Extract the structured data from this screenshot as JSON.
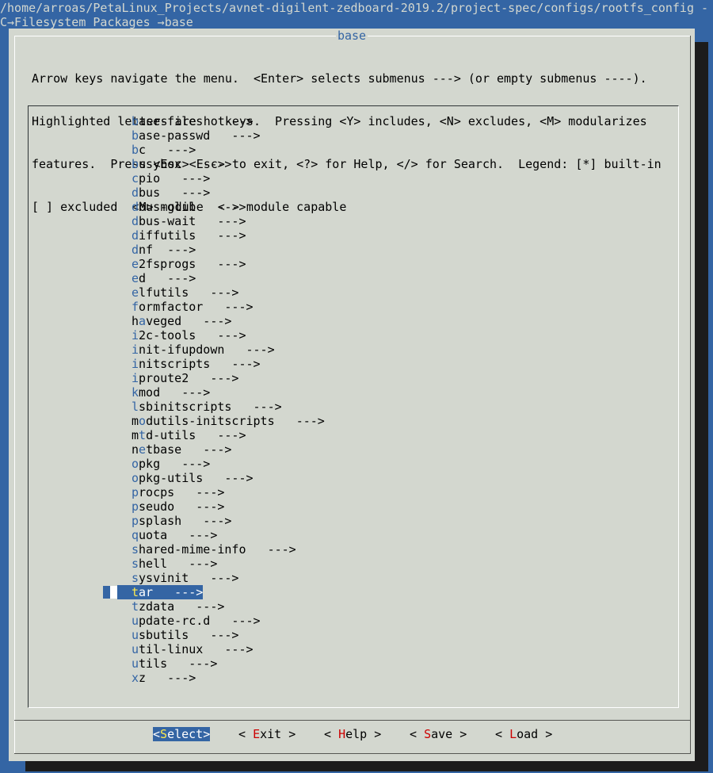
{
  "terminal": {
    "path_line": "/home/arroas/PetaLinux_Projects/avnet-digilent-zedboard-2019.2/project-spec/configs/rootfs_config - ",
    "breadcrumb": "C→Filesystem Packages →base"
  },
  "dialog": {
    "title": "base",
    "help_lines": [
      "Arrow keys navigate the menu.  <Enter> selects submenus ---> (or empty submenus ----).",
      "Highlighted letters are hotkeys.  Pressing <Y> includes, <N> excludes, <M> modularizes",
      "features.  Press <Esc><Esc> to exit, <?> for Help, </> for Search.  Legend: [*] built-in",
      "[ ] excluded  <M> module  < > module capable"
    ]
  },
  "menu": {
    "items": [
      {
        "hot": "b",
        "rest": "ase-files   --->"
      },
      {
        "hot": "b",
        "rest": "ase-passwd   --->"
      },
      {
        "hot": "b",
        "rest": "c   --->"
      },
      {
        "hot": "b",
        "rest": "usybox   --->"
      },
      {
        "hot": "c",
        "rest": "pio   --->"
      },
      {
        "hot": "d",
        "rest": "bus   --->"
      },
      {
        "hot": "d",
        "rest": "bus-glib   --->"
      },
      {
        "hot": "d",
        "rest": "bus-wait   --->"
      },
      {
        "hot": "d",
        "rest": "iffutils   --->"
      },
      {
        "hot": "d",
        "rest": "nf  --->"
      },
      {
        "hot": "e",
        "rest": "2fsprogs   --->"
      },
      {
        "hot": "e",
        "rest": "d   --->"
      },
      {
        "hot": "e",
        "rest": "lfutils   --->"
      },
      {
        "hot": "f",
        "rest": "ormfactor   --->"
      },
      {
        "pre": "h",
        "hot": "a",
        "rest": "veged   --->"
      },
      {
        "hot": "i",
        "rest": "2c-tools   --->"
      },
      {
        "hot": "i",
        "rest": "nit-ifupdown   --->"
      },
      {
        "hot": "i",
        "rest": "nitscripts   --->"
      },
      {
        "hot": "i",
        "rest": "proute2   --->"
      },
      {
        "hot": "k",
        "rest": "mod   --->"
      },
      {
        "hot": "l",
        "rest": "sbinitscripts   --->"
      },
      {
        "pre": "m",
        "hot": "o",
        "rest": "dutils-initscripts   --->"
      },
      {
        "pre": "m",
        "hot": "t",
        "rest": "d-utils   --->"
      },
      {
        "pre": "n",
        "hot": "e",
        "rest": "tbase   --->"
      },
      {
        "hot": "o",
        "rest": "pkg   --->"
      },
      {
        "hot": "o",
        "rest": "pkg-utils   --->"
      },
      {
        "hot": "p",
        "rest": "rocps   --->"
      },
      {
        "hot": "p",
        "rest": "seudo   --->"
      },
      {
        "hot": "p",
        "rest": "splash   --->"
      },
      {
        "hot": "q",
        "rest": "uota   --->"
      },
      {
        "hot": "s",
        "rest": "hared-mime-info   --->"
      },
      {
        "hot": "s",
        "rest": "hell   --->"
      },
      {
        "hot": "s",
        "rest": "ysvinit   --->"
      },
      {
        "hot": "t",
        "rest": "ar   --->",
        "selected": true
      },
      {
        "hot": "t",
        "rest": "zdata   --->"
      },
      {
        "hot": "u",
        "rest": "pdate-rc.d   --->"
      },
      {
        "hot": "u",
        "rest": "sbutils   --->"
      },
      {
        "hot": "u",
        "rest": "til-linux   --->"
      },
      {
        "hot": "u",
        "rest": "tils   --->"
      },
      {
        "hot": "x",
        "rest": "z   --->"
      }
    ]
  },
  "buttons": [
    {
      "pre": "<",
      "hot": "S",
      "post": "elect>",
      "active": true
    },
    {
      "pre": "< ",
      "hot": "E",
      "post": "xit >"
    },
    {
      "pre": "< ",
      "hot": "H",
      "post": "elp >"
    },
    {
      "pre": "< ",
      "hot": "S",
      "post": "ave >"
    },
    {
      "pre": "< ",
      "hot": "L",
      "post": "oad >"
    }
  ],
  "colors": {
    "terminal_bg": "#3465a4",
    "dialog_bg": "#d3d7cf",
    "hotkey_menu": "#3465a4",
    "hotkey_button": "#cc0000",
    "selected_hotkey": "#fce94f"
  }
}
